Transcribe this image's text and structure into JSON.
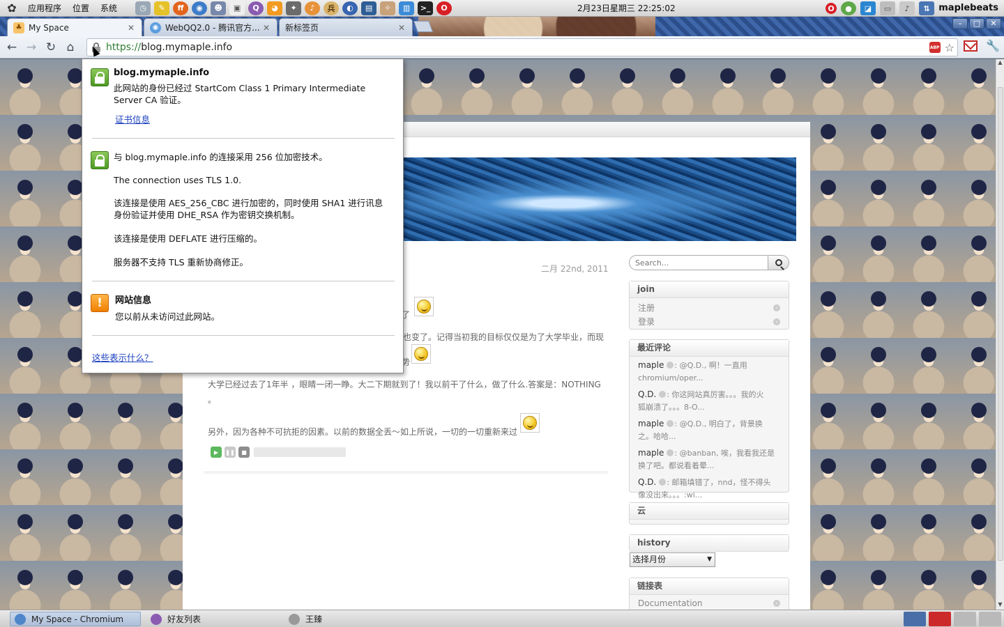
{
  "panel": {
    "menus": [
      "应用程序",
      "位置",
      "系统"
    ],
    "clock": "2月23日星期三 22:25:02",
    "user": "maplebeats"
  },
  "tabs": [
    {
      "title": "My Space",
      "icon": "maple-favicon"
    },
    {
      "title": "WebQQ2.0 - 腾讯官方...",
      "icon": "webqq-favicon"
    },
    {
      "title": "新标签页",
      "icon": ""
    }
  ],
  "omnibox": {
    "scheme": "https://",
    "host": "blog.mymaple.info"
  },
  "security_popup": {
    "identity_title": "blog.mymaple.info",
    "identity_text_1": "此网站的身份已经过 StartCom Class 1 Primary Intermediate",
    "identity_text_2": "Server CA 验证。",
    "cert_link": "证书信息",
    "conn_text_1": "与 blog.mymaple.info 的连接采用 256 位加密技术。",
    "conn_text_2": "The connection uses TLS 1.0.",
    "conn_text_3a": "该连接是使用 AES_256_CBC 进行加密的，同时使用 SHA1 进行讯息",
    "conn_text_3b": "身份验证并使用 DHE_RSA 作为密钥交换机制。",
    "conn_text_4": "该连接是使用 DEFLATE 进行压缩的。",
    "conn_text_5": "服务器不支持 TLS 重新协商修正。",
    "site_info_title": "网站信息",
    "site_info_text": "您以前从未访问过此网站。",
    "help_link": "这些表示什么？"
  },
  "post": {
    "date": "二月 22nd, 2011",
    "line1_tail": "了",
    "line2_tail": "也变了。记得当初我的目标仅仅是为了大学毕业，而现",
    "line3_tail": "势",
    "para2": "大学已经过去了1年半 ，眼睛一闭一睁。大二下期就到了！我以前干了什么，做了什么.答案是：NOTHING",
    "para2_cont": "。",
    "para3": "另外，因为各种不可抗拒的因素。以前的数据全丢～如上所说，一切的一切重新来过"
  },
  "sidebar": {
    "search_placeholder": "Search...",
    "join": {
      "title": "join",
      "items": [
        "注册",
        "登录"
      ]
    },
    "recent_comments": {
      "title": "最近评论",
      "items": [
        {
          "author": "maple",
          "text_1": ": @Q.D., 啊！一直用",
          "text_2": "chromium/oper..."
        },
        {
          "author": "Q.D.",
          "text_1": ": 你这网站真厉害。。。我的火",
          "text_2": "狐崩溃了。。。8-O..."
        },
        {
          "author": "maple",
          "text_1": ": @Q.D., 明白了，背景换",
          "text_2": "之。哈哈..."
        },
        {
          "author": "maple",
          "text_1": ": @banban, 唉，我看我还是",
          "text_2": "换了吧。都说看着晕..."
        },
        {
          "author": "Q.D.",
          "text_1": ": 邮箱填错了，nnd，怪不得头",
          "text_2": "像没出来。。。:wi..."
        }
      ]
    },
    "cloud": {
      "title": "云"
    },
    "history": {
      "title": "history",
      "select_value": "选择月份"
    },
    "links": {
      "title": "链接表",
      "items": [
        "Documentation"
      ]
    }
  },
  "taskbar": {
    "items": [
      "My Space - Chromium",
      "好友列表",
      "王臻"
    ]
  },
  "colors": {
    "https_green": "#2e7d32",
    "link_blue": "#1a3fbf",
    "tabstrip_blue": "#2c4f8c",
    "warn_orange": "#f07f00"
  }
}
